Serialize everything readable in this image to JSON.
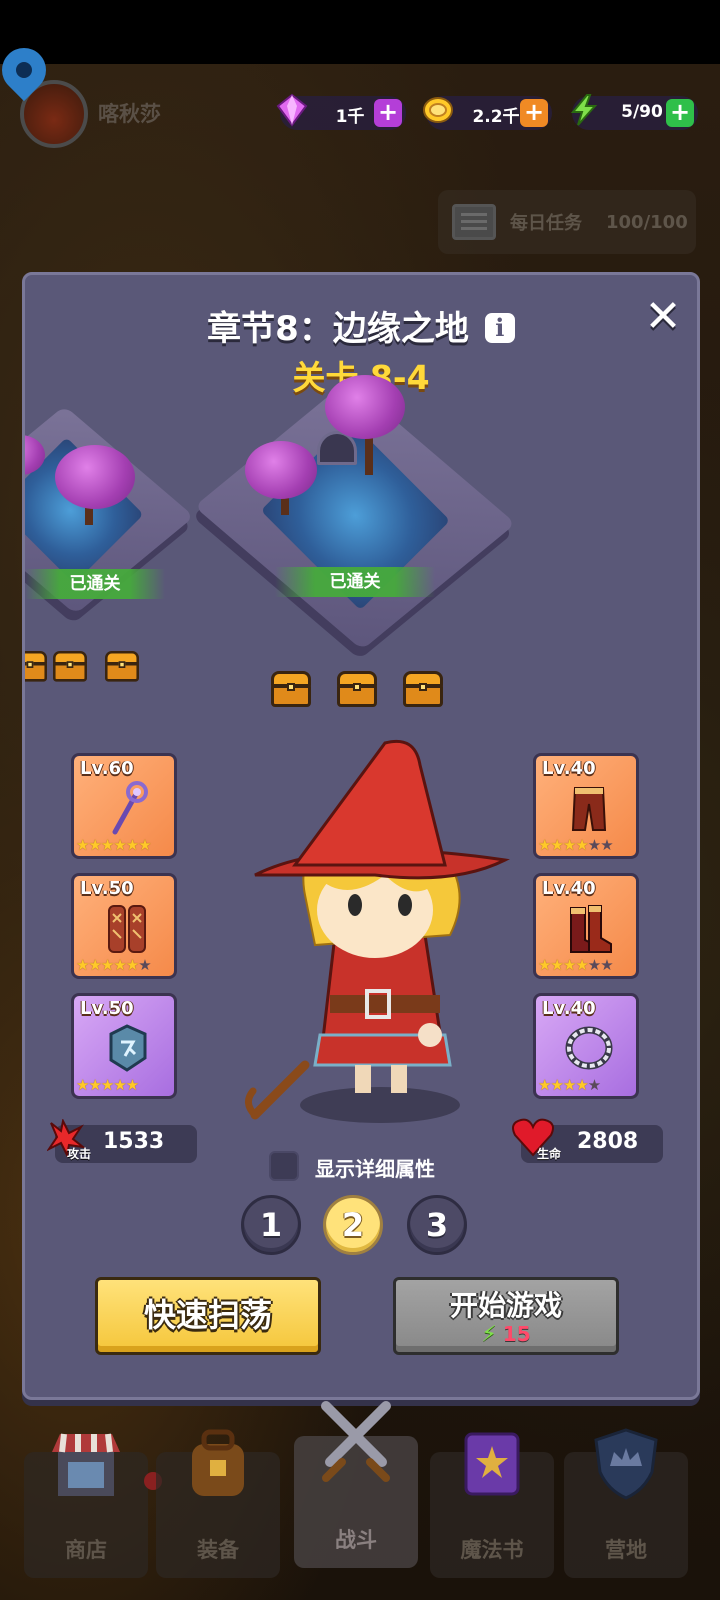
{
  "player": {
    "name": "喀秋莎"
  },
  "resources": [
    {
      "id": "gems",
      "icon": "gem-icon",
      "value": "1千",
      "color": "#c23bd8"
    },
    {
      "id": "coins",
      "icon": "coin-icon",
      "value": "2.2千",
      "color": "#f08a24"
    },
    {
      "id": "energy",
      "icon": "lightning-icon",
      "value": "5/90",
      "color": "#2fbf4a"
    }
  ],
  "daily_tasks": {
    "label": "每日任务",
    "value": "100/100"
  },
  "modal": {
    "chapter_title": "章节8：边缘之地",
    "level_title": "关卡 8-4",
    "stages": [
      {
        "status": "已通关"
      },
      {
        "status": "已通关"
      }
    ],
    "equipment": {
      "left": [
        {
          "level": "Lv.60",
          "stars": 6,
          "max_stars": 6,
          "rarity": "orange",
          "icon": "staff-icon"
        },
        {
          "level": "Lv.50",
          "stars": 5,
          "max_stars": 6,
          "rarity": "orange",
          "icon": "robe-icon"
        },
        {
          "level": "Lv.50",
          "stars": 5,
          "max_stars": 5,
          "rarity": "purple",
          "icon": "rune-icon"
        }
      ],
      "right": [
        {
          "level": "Lv.40",
          "stars": 4,
          "max_stars": 6,
          "rarity": "orange",
          "icon": "pants-icon"
        },
        {
          "level": "Lv.40",
          "stars": 4,
          "max_stars": 6,
          "rarity": "orange",
          "icon": "boots-icon"
        },
        {
          "level": "Lv.40",
          "stars": 4,
          "max_stars": 5,
          "rarity": "purple",
          "icon": "necklace-icon"
        }
      ]
    },
    "attack": {
      "label": "攻击",
      "value": "1533"
    },
    "hp": {
      "label": "生命",
      "value": "2808"
    },
    "show_details_label": "显示详细属性",
    "teams": [
      "1",
      "2",
      "3"
    ],
    "active_team": "2",
    "sweep_button": "快速扫荡",
    "start_button": {
      "label": "开始游戏",
      "cost": "15"
    }
  },
  "nav": [
    {
      "label": "商店",
      "icon": "shop-icon"
    },
    {
      "label": "装备",
      "icon": "backpack-icon"
    },
    {
      "label": "战斗",
      "icon": "crossed-swords-icon"
    },
    {
      "label": "魔法书",
      "icon": "spellbook-icon"
    },
    {
      "label": "营地",
      "icon": "shield-crown-icon"
    }
  ]
}
